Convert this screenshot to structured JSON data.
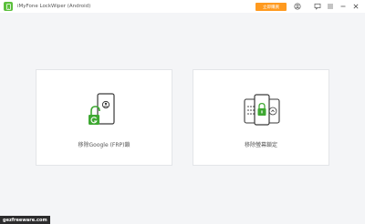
{
  "window": {
    "title": "iMyFone LockWiper (Android)",
    "buy_label": "立即購買"
  },
  "toolbar": {
    "icons": [
      "user-icon",
      "feedback-icon",
      "menu-icon",
      "minimize-icon",
      "close-icon"
    ]
  },
  "cards": [
    {
      "label": "移除Google (FRP)鎖",
      "icon": "phone-google-unlock-icon"
    },
    {
      "label": "移除螢幕鎖定",
      "icon": "phones-screen-lock-icon"
    }
  ],
  "watermark": "gezfreeware.com",
  "colors": {
    "accent": "#ff9a1f",
    "brand_green": "#5bbf3c",
    "background": "#f4f5f7"
  }
}
